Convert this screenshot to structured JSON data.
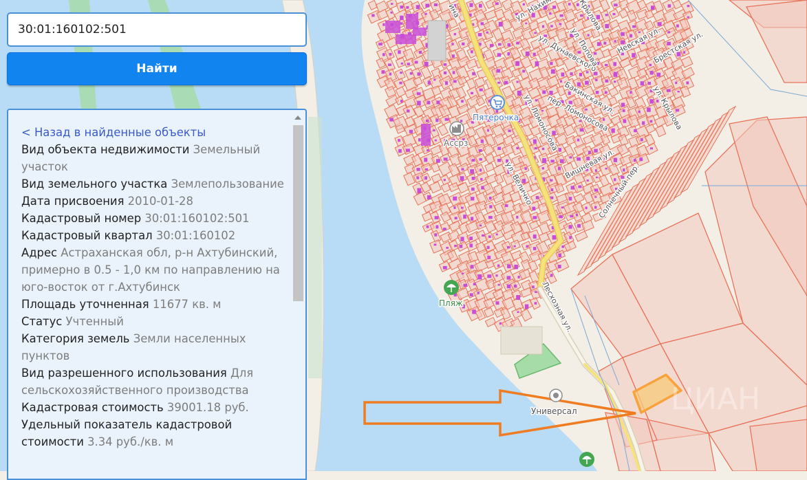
{
  "search": {
    "query": "30:01:160102:501",
    "button_label": "Найти"
  },
  "panel": {
    "back_link": "< Назад в найденные объекты",
    "properties": [
      {
        "label": "Вид объекта недвижимости",
        "value": "Земельный участок"
      },
      {
        "label": "Вид земельного участка",
        "value": "Землепользование"
      },
      {
        "label": "Дата присвоения",
        "value": "2010-01-28"
      },
      {
        "label": "Кадастровый номер",
        "value": "30:01:160102:501"
      },
      {
        "label": "Кадастровый квартал",
        "value": "30:01:160102"
      },
      {
        "label": "Адрес",
        "value": "Астраханская обл, р-н Ахтубинский, примерно в 0.5 - 1,0 км по направлению на юго-восток от г.Ахтубинск"
      },
      {
        "label": "Площадь уточненная",
        "value": "11677 кв. м"
      },
      {
        "label": "Статус",
        "value": "Учтенный"
      },
      {
        "label": "Категория земель",
        "value": "Земли населенных пунктов"
      },
      {
        "label": "Вид разрешенного использования",
        "value": "Для сельскохозяйственного производства"
      },
      {
        "label": "Кадастровая стоимость",
        "value": "39001.18 руб."
      },
      {
        "label": "Удельный показатель кадастровой стоимости",
        "value": "3.34 руб./кв. м"
      }
    ]
  },
  "map": {
    "streets": {
      "nakhimova": "ул. Нахимова",
      "krylova_top": "Крылова",
      "dunaevskogo": "ул. Дунаевского",
      "popova": "ул. Попова",
      "nevskaya": "Невская ул.",
      "brestskaya": "Брестская ул.",
      "bakinskaya": "Бакинская ул.",
      "lomonosova_per": "пер. Ломоносова",
      "lomonosova": "ул. Ломоносова",
      "krylova": "ул. Крылова",
      "velichko": "ул. Величко",
      "vishnevaya": "Вишневая ул.",
      "solnechny": "Солнечный пер.",
      "leskhoznaya": "Лесхозная ул.",
      "street_fragment": "ина"
    },
    "pois": {
      "pyaterochka": "Пятерочка",
      "assrz": "Ассрз",
      "plyazh": "Пляж",
      "universal": "Универсал"
    },
    "colors": {
      "water": "#b8dcf5",
      "land": "#f3efe6",
      "parcel_outline": "#e8735a",
      "parcel_fill": "#f2c9bd",
      "building": "#c84ed8",
      "road": "#f6e27a",
      "highlight_parcel": "#f7a23a",
      "arrow": "#f07c22",
      "greenery": "#a6dca8"
    }
  }
}
